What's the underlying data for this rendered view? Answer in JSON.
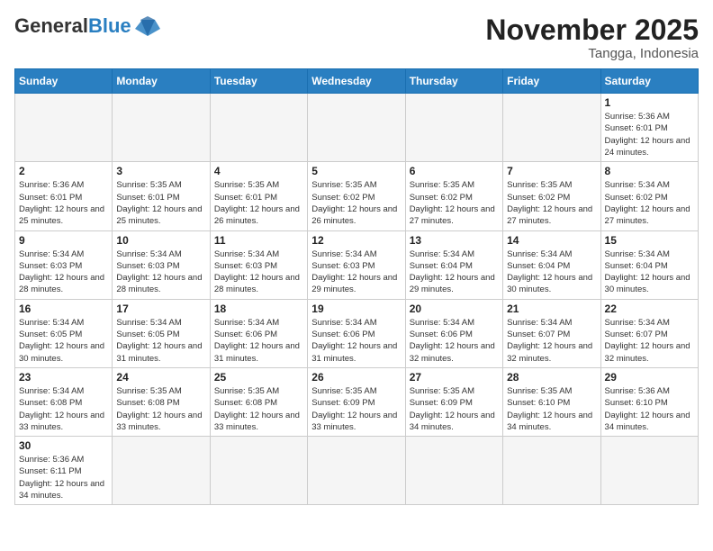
{
  "header": {
    "logo_general": "General",
    "logo_blue": "Blue",
    "month_title": "November 2025",
    "location": "Tangga, Indonesia"
  },
  "days_of_week": [
    "Sunday",
    "Monday",
    "Tuesday",
    "Wednesday",
    "Thursday",
    "Friday",
    "Saturday"
  ],
  "weeks": [
    [
      {
        "day": "",
        "info": ""
      },
      {
        "day": "",
        "info": ""
      },
      {
        "day": "",
        "info": ""
      },
      {
        "day": "",
        "info": ""
      },
      {
        "day": "",
        "info": ""
      },
      {
        "day": "",
        "info": ""
      },
      {
        "day": "1",
        "info": "Sunrise: 5:36 AM\nSunset: 6:01 PM\nDaylight: 12 hours\nand 24 minutes."
      }
    ],
    [
      {
        "day": "2",
        "info": "Sunrise: 5:36 AM\nSunset: 6:01 PM\nDaylight: 12 hours\nand 25 minutes."
      },
      {
        "day": "3",
        "info": "Sunrise: 5:35 AM\nSunset: 6:01 PM\nDaylight: 12 hours\nand 25 minutes."
      },
      {
        "day": "4",
        "info": "Sunrise: 5:35 AM\nSunset: 6:01 PM\nDaylight: 12 hours\nand 26 minutes."
      },
      {
        "day": "5",
        "info": "Sunrise: 5:35 AM\nSunset: 6:02 PM\nDaylight: 12 hours\nand 26 minutes."
      },
      {
        "day": "6",
        "info": "Sunrise: 5:35 AM\nSunset: 6:02 PM\nDaylight: 12 hours\nand 27 minutes."
      },
      {
        "day": "7",
        "info": "Sunrise: 5:35 AM\nSunset: 6:02 PM\nDaylight: 12 hours\nand 27 minutes."
      },
      {
        "day": "8",
        "info": "Sunrise: 5:34 AM\nSunset: 6:02 PM\nDaylight: 12 hours\nand 27 minutes."
      }
    ],
    [
      {
        "day": "9",
        "info": "Sunrise: 5:34 AM\nSunset: 6:03 PM\nDaylight: 12 hours\nand 28 minutes."
      },
      {
        "day": "10",
        "info": "Sunrise: 5:34 AM\nSunset: 6:03 PM\nDaylight: 12 hours\nand 28 minutes."
      },
      {
        "day": "11",
        "info": "Sunrise: 5:34 AM\nSunset: 6:03 PM\nDaylight: 12 hours\nand 28 minutes."
      },
      {
        "day": "12",
        "info": "Sunrise: 5:34 AM\nSunset: 6:03 PM\nDaylight: 12 hours\nand 29 minutes."
      },
      {
        "day": "13",
        "info": "Sunrise: 5:34 AM\nSunset: 6:04 PM\nDaylight: 12 hours\nand 29 minutes."
      },
      {
        "day": "14",
        "info": "Sunrise: 5:34 AM\nSunset: 6:04 PM\nDaylight: 12 hours\nand 30 minutes."
      },
      {
        "day": "15",
        "info": "Sunrise: 5:34 AM\nSunset: 6:04 PM\nDaylight: 12 hours\nand 30 minutes."
      }
    ],
    [
      {
        "day": "16",
        "info": "Sunrise: 5:34 AM\nSunset: 6:05 PM\nDaylight: 12 hours\nand 30 minutes."
      },
      {
        "day": "17",
        "info": "Sunrise: 5:34 AM\nSunset: 6:05 PM\nDaylight: 12 hours\nand 31 minutes."
      },
      {
        "day": "18",
        "info": "Sunrise: 5:34 AM\nSunset: 6:06 PM\nDaylight: 12 hours\nand 31 minutes."
      },
      {
        "day": "19",
        "info": "Sunrise: 5:34 AM\nSunset: 6:06 PM\nDaylight: 12 hours\nand 31 minutes."
      },
      {
        "day": "20",
        "info": "Sunrise: 5:34 AM\nSunset: 6:06 PM\nDaylight: 12 hours\nand 32 minutes."
      },
      {
        "day": "21",
        "info": "Sunrise: 5:34 AM\nSunset: 6:07 PM\nDaylight: 12 hours\nand 32 minutes."
      },
      {
        "day": "22",
        "info": "Sunrise: 5:34 AM\nSunset: 6:07 PM\nDaylight: 12 hours\nand 32 minutes."
      }
    ],
    [
      {
        "day": "23",
        "info": "Sunrise: 5:34 AM\nSunset: 6:08 PM\nDaylight: 12 hours\nand 33 minutes."
      },
      {
        "day": "24",
        "info": "Sunrise: 5:35 AM\nSunset: 6:08 PM\nDaylight: 12 hours\nand 33 minutes."
      },
      {
        "day": "25",
        "info": "Sunrise: 5:35 AM\nSunset: 6:08 PM\nDaylight: 12 hours\nand 33 minutes."
      },
      {
        "day": "26",
        "info": "Sunrise: 5:35 AM\nSunset: 6:09 PM\nDaylight: 12 hours\nand 33 minutes."
      },
      {
        "day": "27",
        "info": "Sunrise: 5:35 AM\nSunset: 6:09 PM\nDaylight: 12 hours\nand 34 minutes."
      },
      {
        "day": "28",
        "info": "Sunrise: 5:35 AM\nSunset: 6:10 PM\nDaylight: 12 hours\nand 34 minutes."
      },
      {
        "day": "29",
        "info": "Sunrise: 5:36 AM\nSunset: 6:10 PM\nDaylight: 12 hours\nand 34 minutes."
      }
    ],
    [
      {
        "day": "30",
        "info": "Sunrise: 5:36 AM\nSunset: 6:11 PM\nDaylight: 12 hours\nand 34 minutes."
      },
      {
        "day": "",
        "info": ""
      },
      {
        "day": "",
        "info": ""
      },
      {
        "day": "",
        "info": ""
      },
      {
        "day": "",
        "info": ""
      },
      {
        "day": "",
        "info": ""
      },
      {
        "day": "",
        "info": ""
      }
    ]
  ]
}
